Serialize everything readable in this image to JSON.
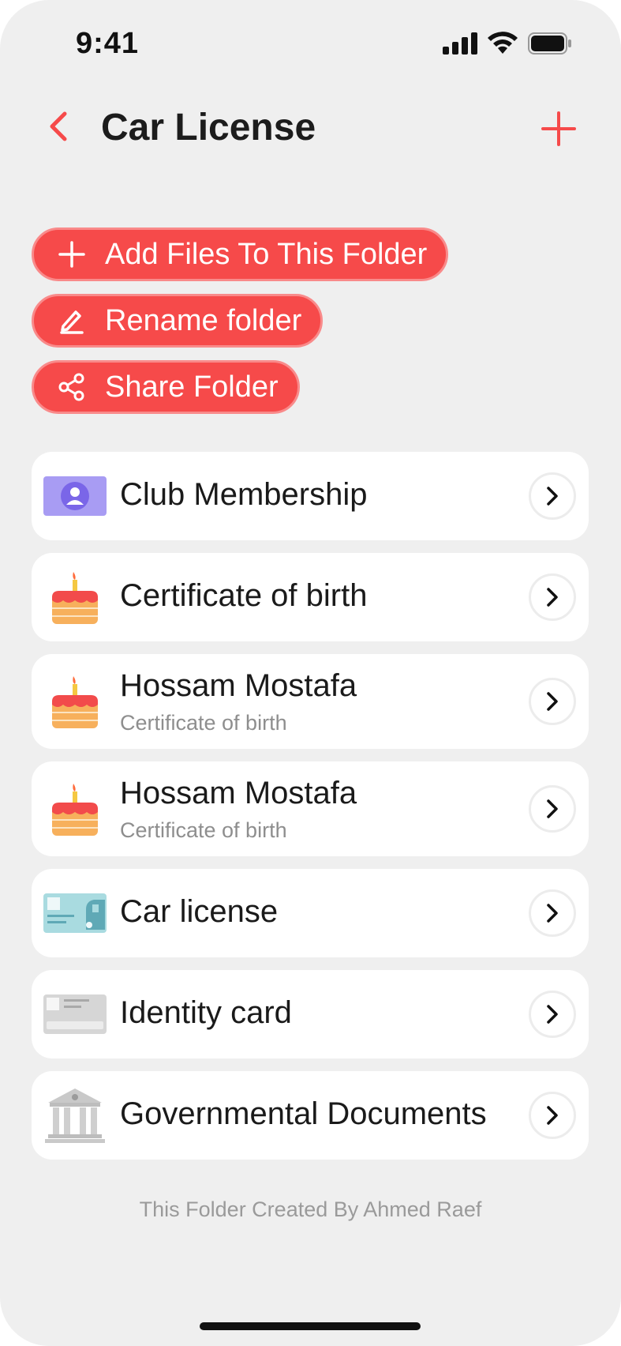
{
  "status_bar": {
    "time": "9:41"
  },
  "header": {
    "title": "Car License"
  },
  "actions": [
    {
      "label": "Add Files To This Folder",
      "icon": "plus-icon"
    },
    {
      "label": "Rename folder",
      "icon": "pencil-icon"
    },
    {
      "label": "Share Folder",
      "icon": "share-icon"
    }
  ],
  "items": [
    {
      "title": "Club Membership",
      "subtitle": "",
      "icon": "membership-card-icon"
    },
    {
      "title": "Certificate of birth",
      "subtitle": "",
      "icon": "birthday-cake-icon"
    },
    {
      "title": "Hossam Mostafa",
      "subtitle": "Certificate of birth",
      "icon": "birthday-cake-icon"
    },
    {
      "title": "Hossam Mostafa",
      "subtitle": "Certificate of birth",
      "icon": "birthday-cake-icon"
    },
    {
      "title": "Car license",
      "subtitle": "",
      "icon": "car-license-card-icon"
    },
    {
      "title": "Identity card",
      "subtitle": "",
      "icon": "id-card-icon"
    },
    {
      "title": "Governmental Documents",
      "subtitle": "",
      "icon": "government-building-icon"
    }
  ],
  "footer": {
    "note": "This Folder Created By Ahmed Raef"
  },
  "colors": {
    "accent": "#f64a4a",
    "background": "#efefef",
    "card": "#ffffff"
  }
}
